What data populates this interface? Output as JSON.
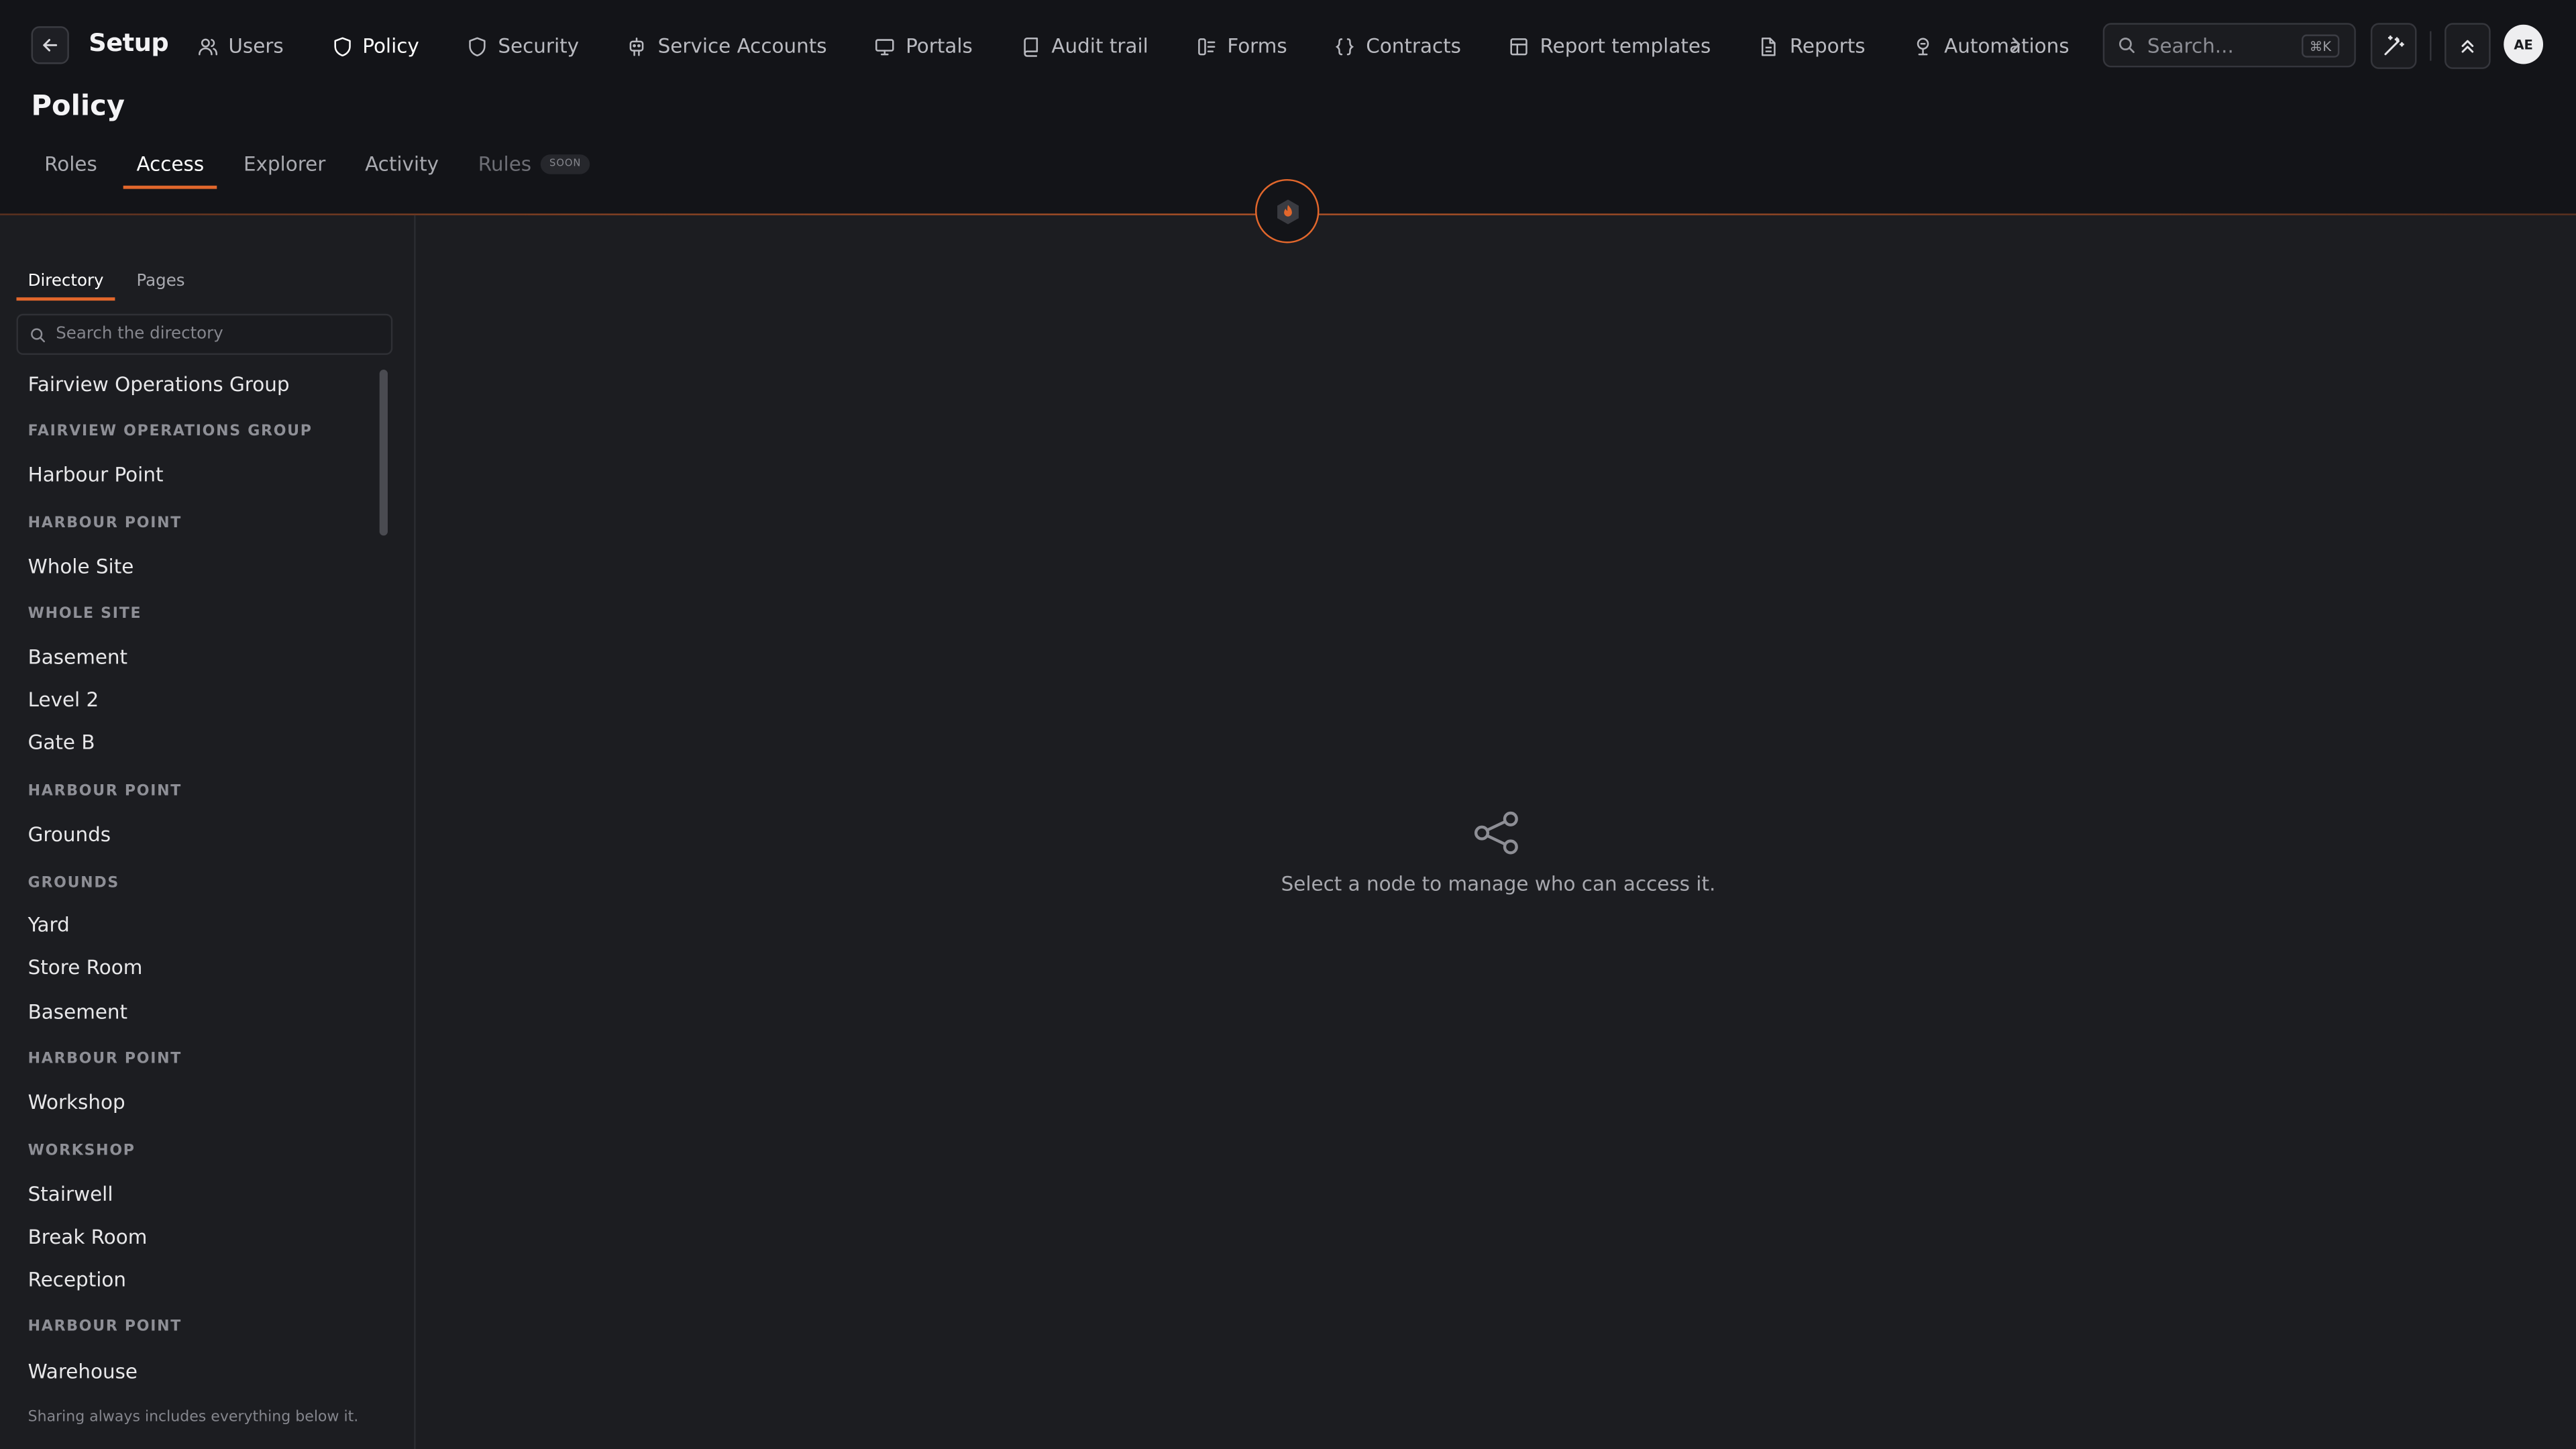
{
  "app": {
    "title": "Setup",
    "avatar_initials": "AE"
  },
  "nav": {
    "items": [
      {
        "label": "Users",
        "icon": "users-icon",
        "active": false
      },
      {
        "label": "Policy",
        "icon": "shield-icon",
        "active": true
      },
      {
        "label": "Security",
        "icon": "shield-check-icon",
        "active": false
      },
      {
        "label": "Service Accounts",
        "icon": "robot-icon",
        "active": false
      },
      {
        "label": "Portals",
        "icon": "monitor-icon",
        "active": false
      },
      {
        "label": "Audit trail",
        "icon": "book-icon",
        "active": false
      },
      {
        "label": "Forms",
        "icon": "form-icon",
        "active": false
      },
      {
        "label": "Contracts",
        "icon": "braces-icon",
        "active": false
      },
      {
        "label": "Report templates",
        "icon": "template-icon",
        "active": false
      },
      {
        "label": "Reports",
        "icon": "file-icon",
        "active": false
      },
      {
        "label": "Automations",
        "icon": "automation-icon",
        "active": false
      }
    ]
  },
  "search": {
    "placeholder": "Search...",
    "shortcut": "⌘K"
  },
  "page": {
    "title": "Policy",
    "tabs": [
      {
        "label": "Roles",
        "active": false
      },
      {
        "label": "Access",
        "active": true
      },
      {
        "label": "Explorer",
        "active": false
      },
      {
        "label": "Activity",
        "active": false
      },
      {
        "label": "Rules",
        "active": false,
        "badge": "SOON"
      }
    ]
  },
  "sidebar": {
    "tabs": [
      {
        "label": "Directory",
        "active": true
      },
      {
        "label": "Pages",
        "active": false
      }
    ],
    "search_placeholder": "Search the directory",
    "tree": [
      {
        "kind": "node",
        "label": "Fairview Operations Group"
      },
      {
        "kind": "group",
        "label": "FAIRVIEW OPERATIONS GROUP"
      },
      {
        "kind": "node",
        "label": "Harbour Point"
      },
      {
        "kind": "group",
        "label": "HARBOUR POINT"
      },
      {
        "kind": "node",
        "label": "Whole Site"
      },
      {
        "kind": "group",
        "label": "WHOLE SITE"
      },
      {
        "kind": "node",
        "label": "Basement"
      },
      {
        "kind": "node",
        "label": "Level 2"
      },
      {
        "kind": "node",
        "label": "Gate B"
      },
      {
        "kind": "group",
        "label": "HARBOUR POINT"
      },
      {
        "kind": "node",
        "label": "Grounds"
      },
      {
        "kind": "group",
        "label": "GROUNDS"
      },
      {
        "kind": "node",
        "label": "Yard"
      },
      {
        "kind": "node",
        "label": "Store Room"
      },
      {
        "kind": "node",
        "label": "Basement"
      },
      {
        "kind": "group",
        "label": "HARBOUR POINT"
      },
      {
        "kind": "node",
        "label": "Workshop"
      },
      {
        "kind": "group",
        "label": "WORKSHOP"
      },
      {
        "kind": "node",
        "label": "Stairwell"
      },
      {
        "kind": "node",
        "label": "Break Room"
      },
      {
        "kind": "node",
        "label": "Reception"
      },
      {
        "kind": "group",
        "label": "HARBOUR POINT"
      },
      {
        "kind": "node",
        "label": "Warehouse"
      }
    ],
    "footer": "Sharing always includes everything below it."
  },
  "main": {
    "empty_message": "Select a node to manage who can access it."
  },
  "colors": {
    "accent": "#e2672c",
    "background": "#1c1d21",
    "header": "#131418"
  }
}
